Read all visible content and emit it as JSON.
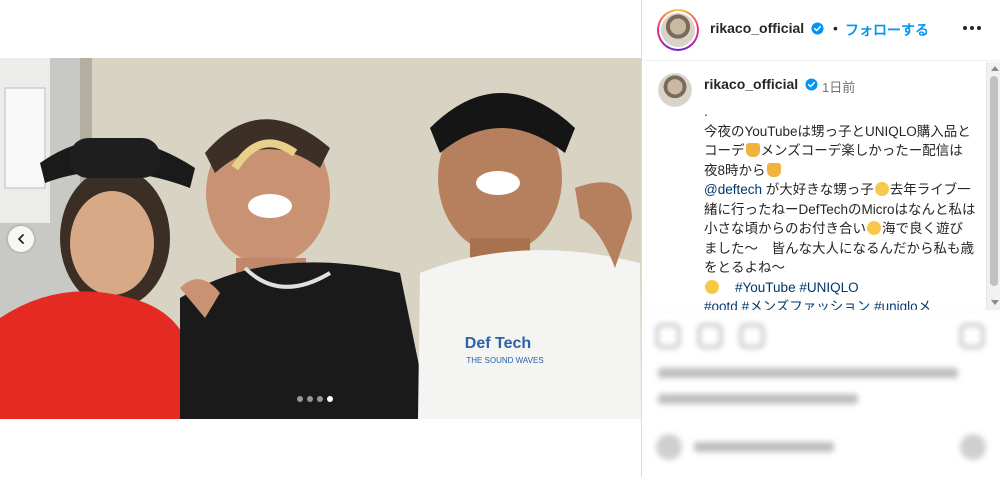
{
  "post": {
    "username": "rikaco_official",
    "follow_label": "フォローする",
    "separator": "•",
    "time_ago": "1日前",
    "caption_intro": ".",
    "caption_p1a": "今夜のYouTubeは甥っ子とUNIQLO購入品とコーデ",
    "caption_p1b": "メンズコーデ楽しかったー配信は夜8時から",
    "mention": "@deftech",
    "caption_p2a": " が大好きな甥っ子",
    "caption_p2b": "去年ライブ一緒に行ったねーDefTechのMicroはなんと私は小さな頃からのお付き合い",
    "caption_p2c": "海で良く遊びました〜　皆んな大人になるんだから私も歳をとるよね〜",
    "hashtag1": "#YouTube",
    "hashtag2": "#UNIQLO",
    "hashtag3": "#ootd",
    "hashtag4": "#メンズファッション",
    "hashtag5": "#uniqloメ"
  },
  "carousel": {
    "slide_count": 4,
    "active_index": 3
  },
  "colors": {
    "follow": "#0095f6",
    "link": "#00376b",
    "verified": "#0095f6"
  },
  "icons": [
    "chevron-left-icon",
    "verified-badge-icon",
    "more-options-icon"
  ]
}
